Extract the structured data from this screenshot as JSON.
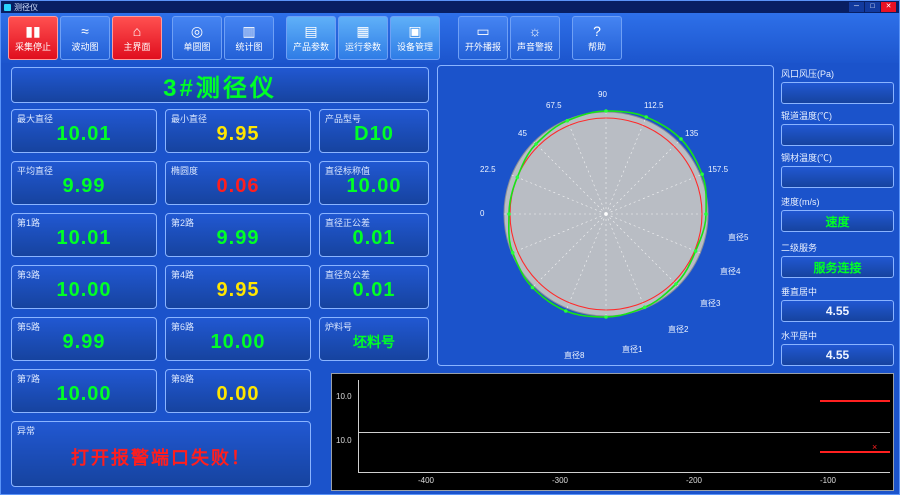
{
  "window": {
    "title": "测径仪",
    "minimize": "─",
    "maximize": "□",
    "close": "✕"
  },
  "toolbar": {
    "buttons": [
      {
        "label": "采集停止",
        "glyph": "▮▮",
        "icon": "stop-acquisition-icon"
      },
      {
        "label": "波动图",
        "glyph": "≈",
        "icon": "wave-chart-icon"
      },
      {
        "label": "主界面",
        "glyph": "⌂",
        "icon": "home-icon"
      },
      {
        "label": "单圆图",
        "glyph": "◎",
        "icon": "single-circle-chart-icon"
      },
      {
        "label": "统计图",
        "glyph": "▥",
        "icon": "statistics-chart-icon"
      },
      {
        "label": "产品参数",
        "glyph": "▤",
        "icon": "product-params-icon"
      },
      {
        "label": "运行参数",
        "glyph": "▦",
        "icon": "run-params-icon"
      },
      {
        "label": "设备管理",
        "glyph": "▣",
        "icon": "device-management-icon"
      },
      {
        "label": "开外播报",
        "glyph": "▭",
        "icon": "external-broadcast-icon"
      },
      {
        "label": "声音警报",
        "glyph": "☼",
        "icon": "sound-alarm-icon"
      },
      {
        "label": "帮助",
        "glyph": "?",
        "icon": "help-icon"
      }
    ]
  },
  "left_panel": {
    "title": "3#测径仪",
    "cells": [
      {
        "label": "最大直径",
        "value": "10.01"
      },
      {
        "label": "最小直径",
        "value": "9.95"
      },
      {
        "label": "产品型号",
        "value": "D10"
      },
      {
        "label": "平均直径",
        "value": "9.99"
      },
      {
        "label": "椭圆度",
        "value": "0.06"
      },
      {
        "label": "直径标称值",
        "value": "10.00"
      },
      {
        "label": "第1路",
        "value": "10.01"
      },
      {
        "label": "第2路",
        "value": "9.99"
      },
      {
        "label": "直径正公差",
        "value": "0.01"
      },
      {
        "label": "第3路",
        "value": "10.00"
      },
      {
        "label": "第4路",
        "value": "9.95"
      },
      {
        "label": "直径负公差",
        "value": "0.01"
      },
      {
        "label": "第5路",
        "value": "9.99"
      },
      {
        "label": "第6路",
        "value": "10.00"
      },
      {
        "label": "炉料号",
        "value": "坯料号"
      },
      {
        "label": "第7路",
        "value": "10.00"
      },
      {
        "label": "第8路",
        "value": "0.00"
      },
      {
        "label": "异常",
        "value": "打开报警端口失败！"
      }
    ]
  },
  "polar": {
    "angle_labels": [
      "90",
      "112.5",
      "135",
      "157.5",
      "67.5",
      "45",
      "22.5",
      "0"
    ],
    "diameter_labels": [
      "直径5",
      "直径4",
      "直径3",
      "直径2",
      "直径1",
      "直径8"
    ],
    "base_radius": 100,
    "radii": [
      103,
      105,
      106,
      104,
      100,
      97,
      99,
      101,
      103,
      105,
      104,
      101,
      97,
      96,
      99,
      101
    ]
  },
  "sidebar": {
    "items": [
      {
        "label": "风口风压(Pa)",
        "value": ""
      },
      {
        "label": "辊道温度(℃)",
        "value": ""
      },
      {
        "label": "钢材温度(℃)",
        "value": ""
      },
      {
        "label": "速度(m/s)",
        "value": "速度"
      },
      {
        "label": "二级服务",
        "value": "服务连接"
      },
      {
        "label": "垂直居中",
        "value": "4.55"
      },
      {
        "label": "水平居中",
        "value": "4.55"
      }
    ]
  },
  "trend": {
    "band1_ylabel": "10.0",
    "band2_ylabel": "10.0",
    "x_ticks": [
      "-400",
      "-300",
      "-200",
      "-100"
    ]
  },
  "colors": {
    "background": "#1b53cb",
    "panel_border": "#8ab4ff",
    "value_green": "#00ff26",
    "value_yellow": "#ffe600",
    "alarm_red": "#ff1e1e",
    "button_red": "#e8112d",
    "profile_green": "#17e317",
    "reference_red": "#ff2a2a",
    "gauge_gray": "#b9bdc4"
  }
}
